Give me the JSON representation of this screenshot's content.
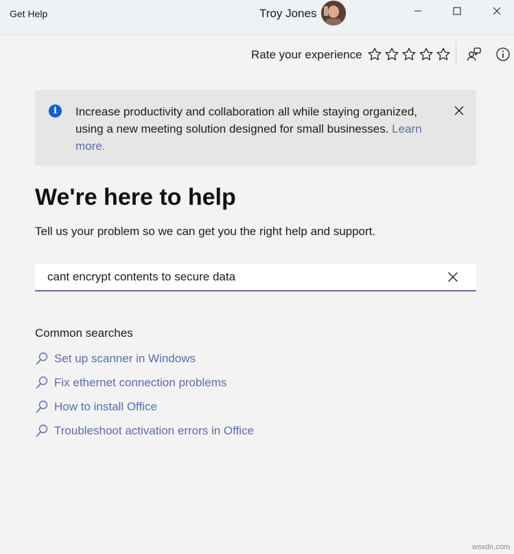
{
  "titlebar": {
    "app_title": "Get Help",
    "user_name": "Troy Jones"
  },
  "rating": {
    "label": "Rate your experience",
    "stars": 5
  },
  "banner": {
    "text": "Increase productivity and collaboration all while staying organized, using a new meeting solution designed for small businesses. ",
    "link": "Learn more."
  },
  "main": {
    "heading": "We're here to help",
    "subheading": "Tell us your problem so we can get you the right help and support."
  },
  "search": {
    "value": "cant encrypt contents to secure data"
  },
  "common": {
    "title": "Common searches",
    "items": [
      "Set up scanner in Windows",
      "Fix ethernet connection problems",
      "How to install Office",
      "Troubleshoot activation errors in Office"
    ]
  },
  "watermark": "wsxdn.com",
  "colors": {
    "accent": "#5b6bb0",
    "info": "#0f62c8",
    "background": "#f3f3f3"
  }
}
